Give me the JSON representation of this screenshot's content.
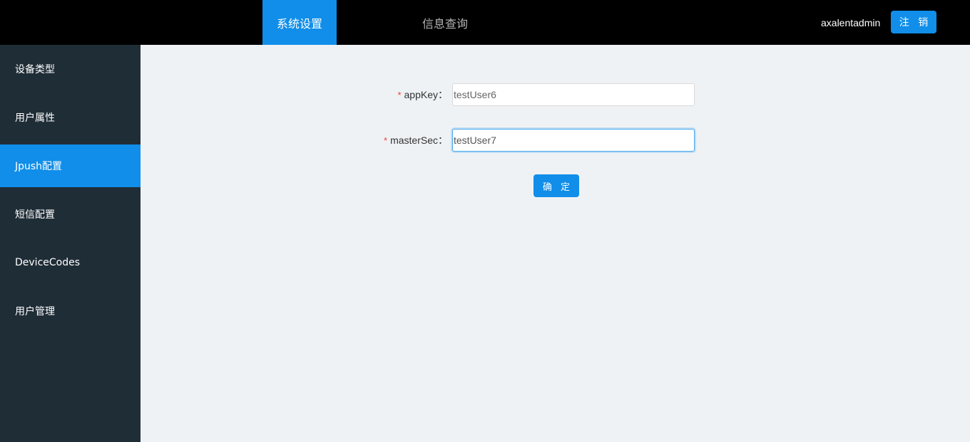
{
  "header": {
    "tabs": [
      {
        "label": "系统设置",
        "active": true
      },
      {
        "label": "信息查询",
        "active": false
      }
    ],
    "username": "axalentadmin",
    "logout_label": "注 销"
  },
  "sidebar": {
    "items": [
      {
        "label": "设备类型",
        "active": false
      },
      {
        "label": "用户属性",
        "active": false
      },
      {
        "label": "Jpush配置",
        "active": true
      },
      {
        "label": "短信配置",
        "active": false
      },
      {
        "label": "DeviceCodes",
        "active": false
      },
      {
        "label": "用户管理",
        "active": false
      }
    ]
  },
  "form": {
    "required_mark": "*",
    "app_key": {
      "label": "appKey：",
      "value": "testUser6"
    },
    "master_sec": {
      "label": "masterSec：",
      "value": "testUser7"
    },
    "submit_label": "确 定"
  },
  "colors": {
    "accent": "#108ee9",
    "topbar": "#000000",
    "sidebar": "#1f2d37",
    "content_bg": "#eff2f5",
    "required": "#f04134"
  }
}
